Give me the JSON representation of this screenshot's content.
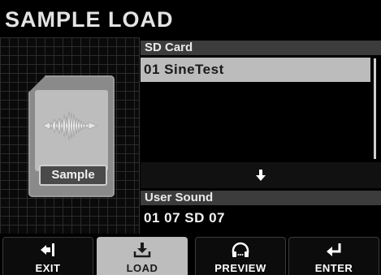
{
  "title": "SAMPLE LOAD",
  "card_label": "Sample",
  "sd_card": {
    "header": "SD Card",
    "items": [
      "01 SineTest"
    ],
    "selected_index": 0
  },
  "user_sound": {
    "header": "User Sound",
    "value": "01 07 SD 07"
  },
  "buttons": [
    {
      "label": "EXIT",
      "icon": "exit-icon"
    },
    {
      "label": "LOAD",
      "icon": "load-icon"
    },
    {
      "label": "PREVIEW",
      "icon": "headphones-icon"
    },
    {
      "label": "ENTER",
      "icon": "enter-icon"
    }
  ],
  "active_button": "LOAD",
  "colors": {
    "background": "#000000",
    "header_bar": "#3c3c3c",
    "selection": "#bcbcbc",
    "card": "#8a8a8a"
  }
}
